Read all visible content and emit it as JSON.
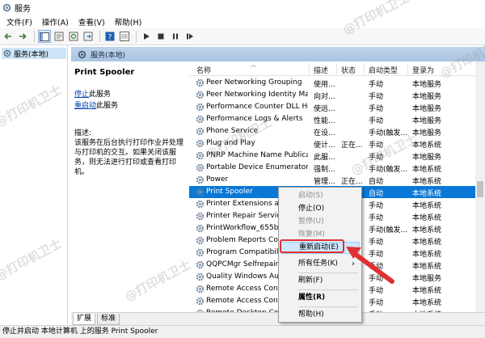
{
  "window": {
    "title": "服务"
  },
  "menubar": {
    "items": [
      "文件(F)",
      "操作(A)",
      "查看(V)",
      "帮助(H)"
    ]
  },
  "tree": {
    "root_label": "服务(本地)"
  },
  "panel": {
    "header": "服务(本地)"
  },
  "details": {
    "service_name": "Print Spooler",
    "stop_link": "停止",
    "stop_suffix": "此服务",
    "restart_link": "重启动",
    "restart_suffix": "此服务",
    "desc_label": "描述:",
    "desc_text": "该服务在后台执行打印作业并处理与打印机的交互。如果关闭该服务，则无法进行打印或查看打印机。"
  },
  "columns": [
    "名称",
    "描述",
    "状态",
    "启动类型",
    "登录为"
  ],
  "services": [
    {
      "name": "Peer Networking Grouping",
      "desc": "使用...",
      "status": "",
      "startup": "手动",
      "logon": "本地服务"
    },
    {
      "name": "Peer Networking Identity Ma...",
      "desc": "向对...",
      "status": "",
      "startup": "手动",
      "logon": "本地服务"
    },
    {
      "name": "Performance Counter DLL Ho...",
      "desc": "使远...",
      "status": "",
      "startup": "手动",
      "logon": "本地服务"
    },
    {
      "name": "Performance Logs & Alerts",
      "desc": "性能...",
      "status": "",
      "startup": "手动",
      "logon": "本地服务"
    },
    {
      "name": "Phone Service",
      "desc": "在设...",
      "status": "",
      "startup": "手动(触发...",
      "logon": "本地服务"
    },
    {
      "name": "Plug and Play",
      "desc": "使计...",
      "status": "正在...",
      "startup": "手动",
      "logon": "本地系统"
    },
    {
      "name": "PNRP Machine Name Publica...",
      "desc": "此服...",
      "status": "",
      "startup": "手动",
      "logon": "本地服务"
    },
    {
      "name": "Portable Device Enumerator ...",
      "desc": "强制...",
      "status": "",
      "startup": "手动(触发...",
      "logon": "本地系统"
    },
    {
      "name": "Power",
      "desc": "管理...",
      "status": "正在...",
      "startup": "自动",
      "logon": "本地系统"
    },
    {
      "name": "Print Spooler",
      "desc": "",
      "status": "",
      "startup": "自动",
      "logon": "本地系统"
    },
    {
      "name": "Printer Extensions and",
      "desc": "",
      "status": "",
      "startup": "手动",
      "logon": "本地系统"
    },
    {
      "name": "Printer Repair Service",
      "desc": "",
      "status": "",
      "startup": "手动",
      "logon": "本地系统"
    },
    {
      "name": "PrintWorkflow_655b9",
      "desc": "",
      "status": "",
      "startup": "手动(触发...",
      "logon": "本地系统"
    },
    {
      "name": "Problem Reports Con",
      "desc": "",
      "status": "",
      "startup": "手动",
      "logon": "本地系统"
    },
    {
      "name": "Program Compatibilit",
      "desc": "",
      "status": "",
      "startup": "手动",
      "logon": "本地系统"
    },
    {
      "name": "QQPCMgr Selfrepair",
      "desc": "",
      "status": "",
      "startup": "手动",
      "logon": "本地系统"
    },
    {
      "name": "Quality Windows Aud",
      "desc": "",
      "status": "",
      "startup": "手动",
      "logon": "本地服务"
    },
    {
      "name": "Remote Access Conn",
      "desc": "",
      "status": "",
      "startup": "手动",
      "logon": "本地系统"
    },
    {
      "name": "Remote Access Conn",
      "desc": "",
      "status": "",
      "startup": "手动",
      "logon": "本地系统"
    },
    {
      "name": "Remote Desktop Con",
      "desc": "",
      "status": "",
      "startup": "手动",
      "logon": "本地系统"
    }
  ],
  "selected_service": "Print Spooler",
  "context_menu": {
    "items": [
      {
        "label": "启动(S)",
        "state": "disabled"
      },
      {
        "label": "停止(O)",
        "state": "enabled"
      },
      {
        "label": "暂停(U)",
        "state": "disabled"
      },
      {
        "label": "恢复(M)",
        "state": "disabled"
      },
      {
        "label": "重新启动(E)",
        "state": "highlighted"
      },
      {
        "label": "所有任务(K)",
        "state": "submenu"
      },
      {
        "label": "刷新(F)",
        "state": "enabled"
      },
      {
        "label": "属性(R)",
        "state": "bold"
      },
      {
        "label": "帮助(H)",
        "state": "enabled"
      }
    ],
    "submenu_arrow": "›"
  },
  "bottom_tabs": [
    "扩展",
    "标准"
  ],
  "statusbar": {
    "text": "停止并启动 本地计算机 上的服务 Print Spooler"
  },
  "watermark": {
    "text": "@打印机卫士"
  },
  "colors": {
    "selection": "#0a78d7",
    "link": "#0645ad",
    "callout": "#e03030",
    "panel_header": "#bdd3ea"
  },
  "icons": [
    "services-app-icon",
    "back-arrow-icon",
    "forward-arrow-icon",
    "console-tree-icon",
    "properties-icon",
    "refresh-icon",
    "export-icon",
    "help-icon",
    "view-icon",
    "play-icon",
    "stop-icon",
    "pause-icon",
    "restart-icon",
    "gear-icon"
  ]
}
